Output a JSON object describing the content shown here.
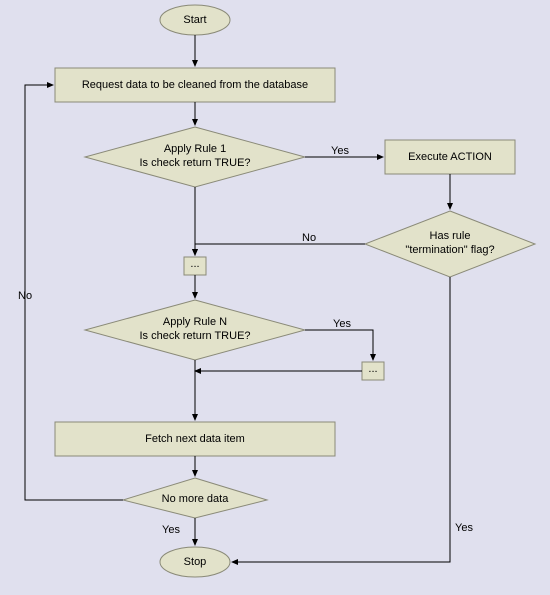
{
  "nodes": {
    "start": {
      "label": "Start"
    },
    "request": {
      "label": "Request data to be cleaned from the database"
    },
    "rule1": {
      "line1": "Apply Rule 1",
      "line2": "Is check return TRUE?"
    },
    "action": {
      "label": "Execute ACTION"
    },
    "termination": {
      "line1": "Has rule",
      "line2": "\"termination\" flag?"
    },
    "dots1": {
      "label": "..."
    },
    "ruleN": {
      "line1": "Apply Rule N",
      "line2": "Is check return TRUE?"
    },
    "dots2": {
      "label": "..."
    },
    "fetch": {
      "label": "Fetch next data item"
    },
    "nomore": {
      "label": "No more data"
    },
    "stop": {
      "label": "Stop"
    }
  },
  "edges": {
    "yes1": "Yes",
    "no1": "No",
    "yes2": "Yes",
    "yes3": "Yes",
    "yes4": "Yes",
    "no2": "No"
  }
}
